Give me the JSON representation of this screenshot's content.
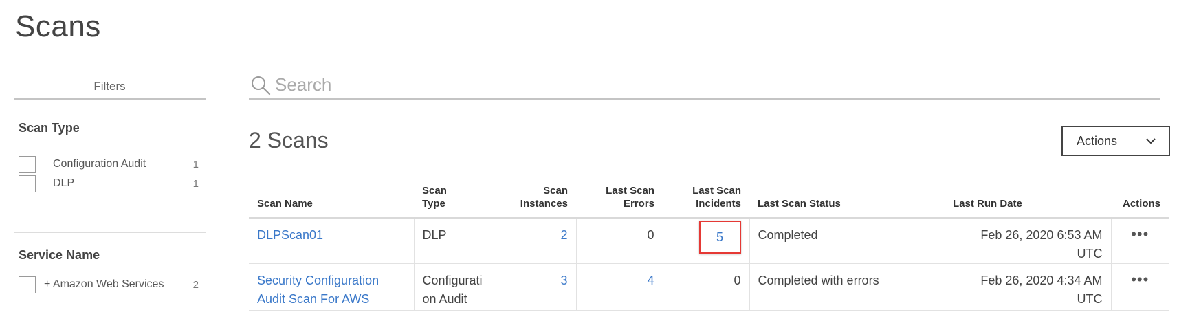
{
  "page": {
    "title": "Scans"
  },
  "filters": {
    "tab_label": "Filters",
    "groups": [
      {
        "title": "Scan Type",
        "options": [
          {
            "label": "Configuration Audit",
            "count": "1"
          },
          {
            "label": "DLP",
            "count": "1"
          }
        ]
      },
      {
        "title": "Service Name",
        "options": [
          {
            "label": "+ Amazon Web Services",
            "count": "2"
          }
        ]
      }
    ]
  },
  "search": {
    "placeholder": "Search"
  },
  "summary": {
    "count_text": "2 Scans"
  },
  "toolbar": {
    "actions_label": "Actions"
  },
  "table": {
    "columns": [
      {
        "line1": "",
        "line2": "Scan Name"
      },
      {
        "line1": "Scan",
        "line2": "Type"
      },
      {
        "line1": "Scan",
        "line2": "Instances"
      },
      {
        "line1": "Last Scan",
        "line2": "Errors"
      },
      {
        "line1": "Last Scan",
        "line2": "Incidents"
      },
      {
        "line1": "",
        "line2": "Last Scan Status"
      },
      {
        "line1": "",
        "line2": "Last Run Date"
      },
      {
        "line1": "",
        "line2": "Actions"
      }
    ],
    "rows": [
      {
        "scan_name": "DLPScan01",
        "scan_type_line1": "DLP",
        "scan_type_line2": "",
        "instances": "2",
        "errors": "0",
        "incidents": "5",
        "status": "Completed",
        "last_run": "Feb 26, 2020 6:53 AM UTC",
        "more": "•••"
      },
      {
        "scan_name_line1": "Security Configuration",
        "scan_name_line2": "Audit Scan For AWS",
        "scan_type_line1": "Configurati",
        "scan_type_line2": "on Audit",
        "instances": "3",
        "errors": "4",
        "incidents": "0",
        "status": "Completed with errors",
        "last_run": "Feb 26, 2020 4:34 AM UTC",
        "more": "•••"
      }
    ]
  },
  "colors": {
    "link": "#3a78c9",
    "highlight": "#e53935"
  },
  "icons": {
    "search": "search-icon",
    "actions_chevron": "chevron-down-icon",
    "row_menu": "more-icon"
  }
}
